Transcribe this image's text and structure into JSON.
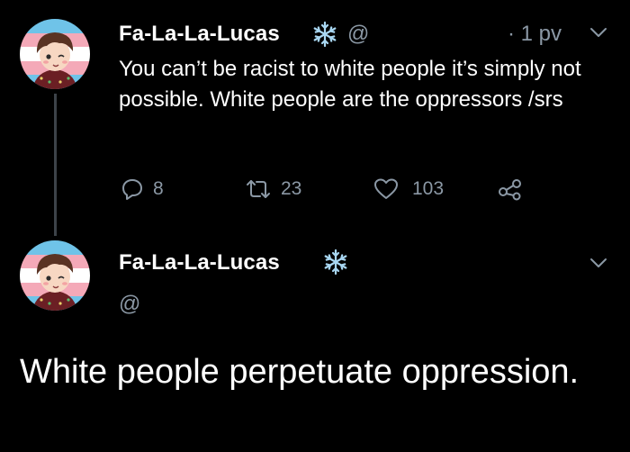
{
  "thread": {
    "tweet1": {
      "author_name": "Fa-La-La-Lucas",
      "handle": "@",
      "time": "· 1 pv",
      "text": "You can’t be racist to white people it’s simply not possible. White people are the oppressors /srs",
      "actions": {
        "reply_count": "8",
        "retweet_count": "23",
        "like_count": "103"
      }
    },
    "tweet2": {
      "author_name": "Fa-La-La-Lucas",
      "handle": "@",
      "text": "White people perpetuate oppression."
    }
  },
  "icons": {
    "badge": "snowflake-icon",
    "reply": "reply-icon",
    "retweet": "retweet-icon",
    "like": "heart-icon",
    "share": "share-icon",
    "menu": "chevron-down-icon"
  },
  "colors": {
    "background": "#000000",
    "text": "#ffffff",
    "muted": "#8b98a5",
    "snowflake": "#a9d7f2",
    "thread_line": "#3d4349"
  }
}
